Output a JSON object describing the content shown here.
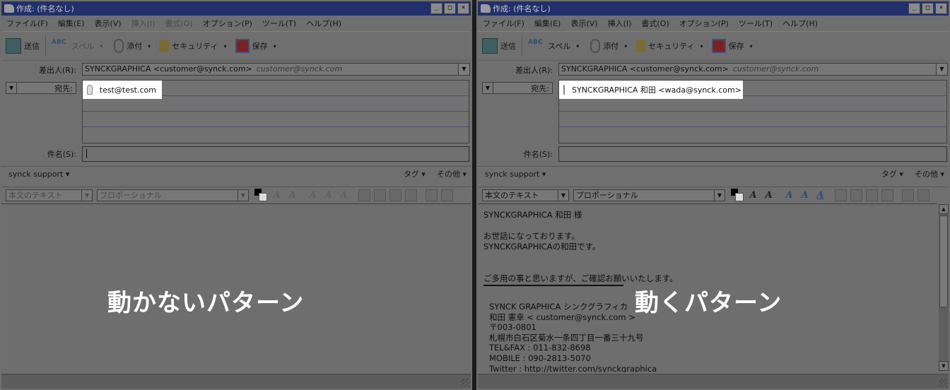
{
  "windows": [
    {
      "title": "作成: (件名なし)",
      "menu": [
        "ファイル(F)",
        "編集(E)",
        "表示(V)",
        "挿入(I)",
        "書式(O)",
        "オプション(P)",
        "ツール(T)",
        "ヘルプ(H)"
      ],
      "toolbar": {
        "send": "送信",
        "spell": "スペル",
        "attach": "添付",
        "security": "セキュリティ",
        "save": "保存"
      },
      "from_label": "差出人(R):",
      "from_value": "SYNCKGRAPHICA <customer@synck.com>",
      "from_alt": "customer@synck.com",
      "to_label": "宛先:",
      "to_value": "test@test.com",
      "subject_label": "件名(S):",
      "identity": "synck support ▾",
      "tags": "タグ ▾",
      "other": "その他 ▾",
      "paragraph_format": "本文のテキスト",
      "font": "プロポーショナル",
      "overlay": "動かないパターン",
      "body": {
        "greeting": "",
        "line1": "",
        "line2": "",
        "line3": "",
        "sig": {
          "company": "",
          "name": "",
          "zip": "",
          "address": "",
          "tel": "",
          "mobile": "",
          "twitter": ""
        }
      }
    },
    {
      "title": "作成: (件名なし)",
      "menu": [
        "ファイル(F)",
        "編集(E)",
        "表示(V)",
        "挿入(I)",
        "書式(O)",
        "オプション(P)",
        "ツール(T)",
        "ヘルプ(H)"
      ],
      "toolbar": {
        "send": "送信",
        "spell": "スペル",
        "attach": "添付",
        "security": "セキュリティ",
        "save": "保存"
      },
      "from_label": "差出人(R):",
      "from_value": "SYNCKGRAPHICA <customer@synck.com>",
      "from_alt": "customer@synck.com",
      "to_label": "宛先:",
      "to_value": "SYNCKGRAPHICA 和田 <wada@synck.com>",
      "subject_label": "件名(S):",
      "identity": "synck support ▾",
      "tags": "タグ ▾",
      "other": "その他 ▾",
      "paragraph_format": "本文のテキスト",
      "font": "プロポーショナル",
      "overlay": "動くパターン",
      "body": {
        "greeting": "SYNCKGRAPHICA 和田 様",
        "line1": "お世話になっております。",
        "line2": "SYNCKGRAPHICAの和田です。",
        "line3": "ご多用の事と思いますが、ご確認お願いいたします。",
        "sig": {
          "company": "SYNCK GRAPHICA シンクグラフィカ",
          "name": "和田 憲幸 < customer@synck.com >",
          "zip": "〒003-0801",
          "address": "札幌市白石区菊水一条四丁目一番三十九号",
          "tel": "TEL&FAX : 011-832-8698",
          "mobile": "MOBILE : 090-2813-5070",
          "twitter": "Twitter  : http://twitter.com/synckgraphica"
        }
      }
    }
  ]
}
